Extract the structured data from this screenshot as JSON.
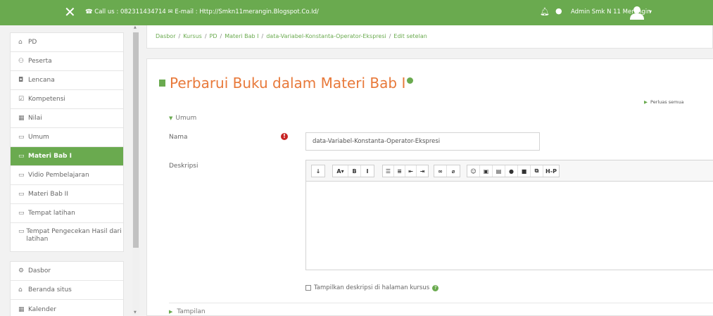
{
  "topbar": {
    "close_icon": "close-icon",
    "contact_text": "☎ Call us : 082311434714 ✉ E-mail : Http://Smkn11merangin.Blogspot.Co.Id/",
    "user_name": "Admin Smk N 11 Merangin",
    "bg_color": "#6aaa4f"
  },
  "sidebar": {
    "items": [
      {
        "label": "PD",
        "icon": "graduation-cap-icon",
        "glyph": "⌂",
        "active": false
      },
      {
        "label": "Peserta",
        "icon": "users-icon",
        "glyph": "⚇",
        "active": false
      },
      {
        "label": "Lencana",
        "icon": "shield-icon",
        "glyph": "◘",
        "active": false
      },
      {
        "label": "Kompetensi",
        "icon": "checkbox-icon",
        "glyph": "☑",
        "active": false
      },
      {
        "label": "Nilai",
        "icon": "table-icon",
        "glyph": "▦",
        "active": false
      },
      {
        "label": "Umum",
        "icon": "folder-icon",
        "glyph": "▭",
        "active": false
      },
      {
        "label": "Materi Bab I",
        "icon": "folder-icon",
        "glyph": "▭",
        "active": true
      },
      {
        "label": "Vidio Pembelajaran",
        "icon": "folder-icon",
        "glyph": "▭",
        "active": false
      },
      {
        "label": "Materi Bab II",
        "icon": "folder-icon",
        "glyph": "▭",
        "active": false
      },
      {
        "label": "Tempat latihan",
        "icon": "folder-icon",
        "glyph": "▭",
        "active": false
      },
      {
        "label": "Tempat Pengecekan Hasil dari latihan",
        "icon": "folder-icon",
        "glyph": "▭",
        "active": false
      }
    ],
    "items2": [
      {
        "label": "Dasbor",
        "icon": "dashboard-icon",
        "glyph": "⚙"
      },
      {
        "label": "Beranda situs",
        "icon": "home-icon",
        "glyph": "⌂"
      },
      {
        "label": "Kalender",
        "icon": "calendar-icon",
        "glyph": "▦"
      }
    ]
  },
  "breadcrumb": [
    "Dasbor",
    "Kursus",
    "PD",
    "Materi Bab I",
    "data-Variabel-Konstanta-Operator-Ekspresi",
    "Edit setelan"
  ],
  "main": {
    "title": "Perbarui Buku dalam Materi Bab I",
    "expand_all": "Perluas semua",
    "section_general": "Umum",
    "name_label": "Nama",
    "name_value": "data-Variabel-Konstanta-Operator-Ekspresi",
    "description_label": "Deskripsi",
    "show_description_label": "Tampilkan deskripsi di halaman kursus",
    "section_appearance": "Tampilan"
  },
  "toolbar": {
    "groups": [
      [
        {
          "name": "toggle-toolbar-button",
          "glyph": "↓"
        }
      ],
      [
        {
          "name": "font-size-button",
          "glyph": "A▾"
        },
        {
          "name": "bold-button",
          "glyph": "B"
        },
        {
          "name": "italic-button",
          "glyph": "I"
        }
      ],
      [
        {
          "name": "bullet-list-button",
          "glyph": "☰"
        },
        {
          "name": "numbered-list-button",
          "glyph": "≡"
        },
        {
          "name": "outdent-button",
          "glyph": "⇤"
        },
        {
          "name": "indent-button",
          "glyph": "⇥"
        }
      ],
      [
        {
          "name": "link-button",
          "glyph": "∞"
        },
        {
          "name": "unlink-button",
          "glyph": "⌀"
        }
      ],
      [
        {
          "name": "emoticon-button",
          "glyph": "☺"
        },
        {
          "name": "image-button",
          "glyph": "▣"
        },
        {
          "name": "media-button",
          "glyph": "▤"
        },
        {
          "name": "record-audio-button",
          "glyph": "●"
        },
        {
          "name": "record-video-button",
          "glyph": "■"
        },
        {
          "name": "manage-files-button",
          "glyph": "⧉"
        },
        {
          "name": "h5p-button",
          "glyph": "H-P"
        }
      ]
    ]
  }
}
